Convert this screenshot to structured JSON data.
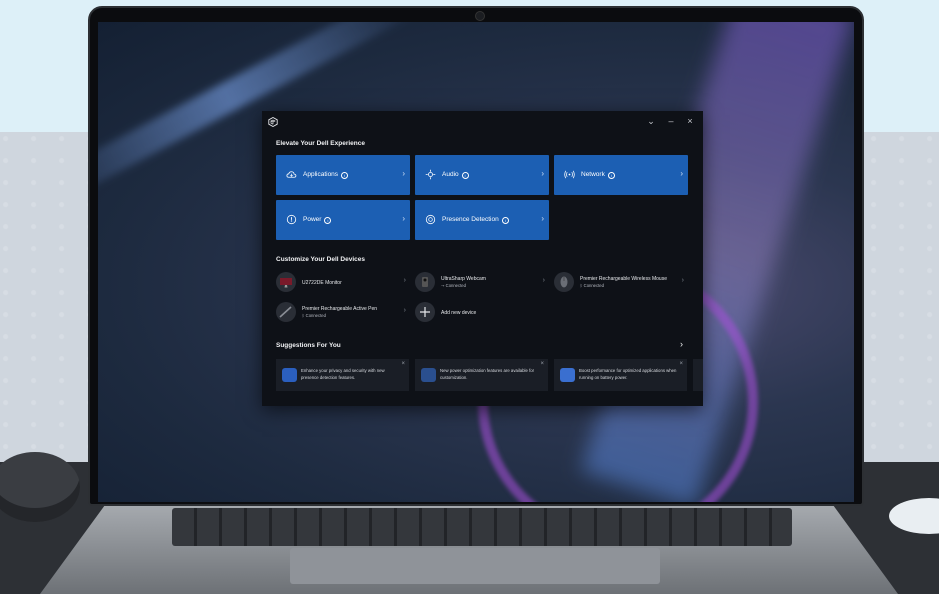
{
  "app": {
    "window_controls": {
      "collapse": "⌄",
      "minimize": "–",
      "close": "×"
    },
    "sections": {
      "experience": "Elevate Your Dell Experience",
      "devices": "Customize Your Dell Devices",
      "suggestions": "Suggestions For You"
    },
    "experience_tiles": [
      {
        "label": "Applications",
        "icon": "cloud-icon"
      },
      {
        "label": "Audio",
        "icon": "audio-icon"
      },
      {
        "label": "Network",
        "icon": "network-icon"
      },
      {
        "label": "Power",
        "icon": "power-icon"
      },
      {
        "label": "Presence Detection",
        "icon": "presence-icon"
      }
    ],
    "devices": [
      {
        "name": "U2722DE Monitor",
        "status": ""
      },
      {
        "name": "UltraSharp Webcam",
        "status": "⊸ Connected"
      },
      {
        "name": "Premier Rechargeable Wireless Mouse",
        "status": "ᛒ Connected"
      },
      {
        "name": "Premier Rechargeable Active Pen",
        "status": "ᛒ Connected"
      },
      {
        "name": "Add new device",
        "status": ""
      }
    ],
    "suggestions": [
      {
        "text": "Enhance your privacy and security with new presence detection features."
      },
      {
        "text": "New power optimization features are available for customization."
      },
      {
        "text": "Boost performance for optimized applications when running on battery power."
      }
    ],
    "colors": {
      "tile_blue": "#1c5fb3",
      "window_bg": "#0e1117"
    }
  }
}
